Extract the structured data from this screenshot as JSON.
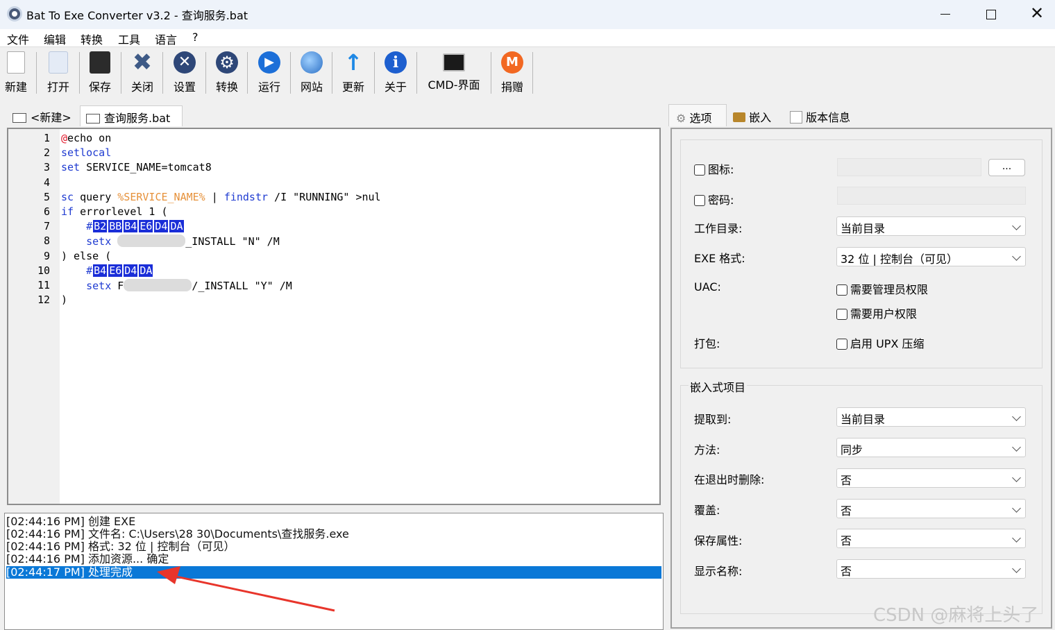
{
  "window": {
    "title": "Bat To Exe Converter v3.2 - 查询服务.bat",
    "close_glyph": "✕"
  },
  "menu": [
    "文件",
    "编辑",
    "转换",
    "工具",
    "语言",
    "?"
  ],
  "toolbar": [
    {
      "label": "新建",
      "icon": "new-file-icon",
      "color": "#ffffff"
    },
    {
      "label": "打开",
      "icon": "open-file-icon",
      "color": "#e8eef8"
    },
    {
      "label": "保存",
      "icon": "save-icon",
      "color": "#2b2b2b"
    },
    {
      "label": "关闭",
      "icon": "close-x-icon",
      "color": "#3e5a86"
    },
    {
      "label": "设置",
      "icon": "settings-icon",
      "color": "#2e4778"
    },
    {
      "label": "转换",
      "icon": "convert-gear-icon",
      "color": "#2e4778"
    },
    {
      "label": "运行",
      "icon": "run-play-icon",
      "color": "#1c6fd8"
    },
    {
      "label": "网站",
      "icon": "globe-icon",
      "color": "#2b6fc4"
    },
    {
      "label": "更新",
      "icon": "update-arrow-icon",
      "color": "#1e88e5"
    },
    {
      "label": "关于",
      "icon": "info-icon",
      "color": "#1d5fcf"
    },
    {
      "label": "CMD-界面",
      "icon": "cmd-console-icon",
      "color": "#1a1a1a"
    },
    {
      "label": "捐赠",
      "icon": "donate-monero-icon",
      "color": "#f26822"
    }
  ],
  "editor_tabs": [
    "<新建>",
    "查询服务.bat"
  ],
  "code_lines": [
    {
      "num": "1",
      "parts": [
        {
          "t": "@",
          "c": "at"
        },
        {
          "t": "echo on",
          "c": ""
        }
      ]
    },
    {
      "num": "2",
      "parts": [
        {
          "t": "setlocal",
          "c": "kw"
        }
      ]
    },
    {
      "num": "3",
      "parts": [
        {
          "t": "set",
          "c": "kw"
        },
        {
          "t": " SERVICE_NAME=tomcat8",
          "c": ""
        }
      ]
    },
    {
      "num": "4",
      "parts": []
    },
    {
      "num": "5",
      "parts": [
        {
          "t": "sc",
          "c": "kw"
        },
        {
          "t": " query ",
          "c": ""
        },
        {
          "t": "%SERVICE_NAME%",
          "c": "var"
        },
        {
          "t": " | ",
          "c": ""
        },
        {
          "t": "findstr",
          "c": "kw"
        },
        {
          "t": " /I \"RUNNING\" >nul",
          "c": ""
        }
      ]
    },
    {
      "num": "6",
      "parts": [
        {
          "t": "if",
          "c": "kw"
        },
        {
          "t": " errorlevel 1 (",
          "c": ""
        }
      ]
    },
    {
      "num": "7",
      "parts": [
        {
          "t": "    #",
          "c": "kw"
        },
        {
          "t": "B2",
          "c": "hex"
        },
        {
          "t": "BB",
          "c": "hex"
        },
        {
          "t": "B4",
          "c": "hex"
        },
        {
          "t": "E6",
          "c": "hex"
        },
        {
          "t": "D4",
          "c": "hex"
        },
        {
          "t": "DA",
          "c": "hex"
        }
      ]
    },
    {
      "num": "8",
      "parts": [
        {
          "t": "    setx",
          "c": "kw"
        },
        {
          "t": " ",
          "c": ""
        },
        {
          "t": "",
          "c": "blur"
        },
        {
          "t": "_INSTALL \"N\" /M",
          "c": ""
        }
      ]
    },
    {
      "num": "9",
      "parts": [
        {
          "t": ") else (",
          "c": ""
        }
      ]
    },
    {
      "num": "10",
      "parts": [
        {
          "t": "    #",
          "c": "kw"
        },
        {
          "t": "B4",
          "c": "hex"
        },
        {
          "t": "E6",
          "c": "hex"
        },
        {
          "t": "D4",
          "c": "hex"
        },
        {
          "t": "DA",
          "c": "hex"
        }
      ]
    },
    {
      "num": "11",
      "parts": [
        {
          "t": "    setx",
          "c": "kw"
        },
        {
          "t": " F",
          "c": ""
        },
        {
          "t": "",
          "c": "blur"
        },
        {
          "t": "/_INSTALL \"Y\" /M",
          "c": ""
        }
      ]
    },
    {
      "num": "12",
      "parts": [
        {
          "t": ")",
          "c": ""
        }
      ]
    }
  ],
  "log": [
    "[02:44:16 PM] 创建 EXE",
    "[02:44:16 PM] 文件名: C:\\Users\\28  30\\Documents\\查找服务.exe",
    "[02:44:16 PM] 格式: 32 位 | 控制台（可见）",
    "[02:44:16 PM] 添加资源... 确定",
    "[02:44:17 PM] 处理完成"
  ],
  "right_tabs": [
    "选项",
    "嵌入",
    "版本信息"
  ],
  "options": {
    "icon_label": "图标:",
    "icon_button": "...",
    "password_label": "密码:",
    "workdir_label": "工作目录:",
    "workdir_value": "当前目录",
    "exe_format_label": "EXE 格式:",
    "exe_format_value": "32 位 | 控制台（可见）",
    "uac_label": "UAC:",
    "uac_admin": "需要管理员权限",
    "uac_user": "需要用户权限",
    "pack_label": "打包:",
    "pack_upx": "启用 UPX 压缩"
  },
  "embedded": {
    "title": "嵌入式项目",
    "rows": [
      {
        "label": "提取到:",
        "value": "当前目录"
      },
      {
        "label": "方法:",
        "value": "同步"
      },
      {
        "label": "在退出时删除:",
        "value": "否"
      },
      {
        "label": "覆盖:",
        "value": "否"
      },
      {
        "label": "保存属性:",
        "value": "否"
      },
      {
        "label": "显示名称:",
        "value": "否"
      }
    ]
  },
  "watermark": "CSDN @麻将上头了"
}
